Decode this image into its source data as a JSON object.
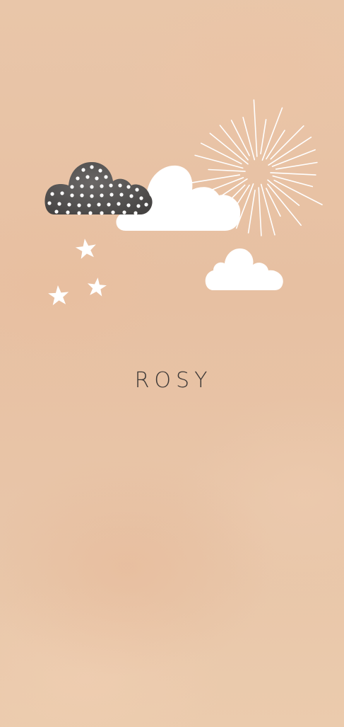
{
  "card": {
    "name": "ROSY"
  },
  "colors": {
    "background": "#e8c4a6",
    "cloud_white": "#ffffff",
    "cloud_dark": "#555352",
    "text": "#3e3937"
  },
  "illustration": {
    "icons": [
      "dotted-cloud-icon",
      "white-cloud-icon",
      "small-cloud-icon",
      "sun-burst-icon",
      "star-icon"
    ]
  }
}
